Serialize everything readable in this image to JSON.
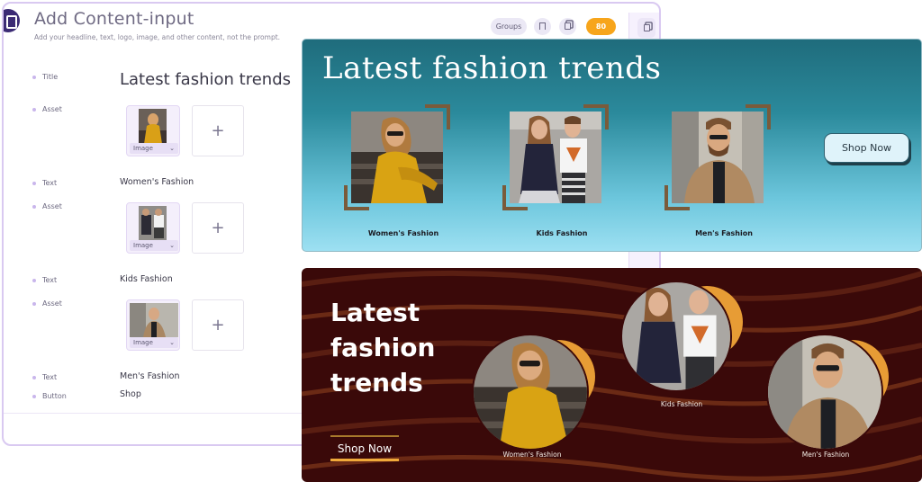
{
  "editor": {
    "title": "Add Content-input",
    "subtitle": "Add your headline, text, logo, image, and other content, not the prompt.",
    "groups_label": "Groups",
    "credits": "80",
    "rows": {
      "title_label": "Title",
      "title_value": "Latest fashion trends",
      "asset_label": "Asset",
      "text_label": "Text",
      "button_label": "Button",
      "asset_type": "Image",
      "text1_value": "Women's Fashion",
      "text2_value": "Kids Fashion",
      "text3_value": "Men's Fashion",
      "button_value": "Shop",
      "add_symbol": "+"
    }
  },
  "banner_teal": {
    "headline": "Latest fashion trends",
    "captions": [
      "Women's Fashion",
      "Kids Fashion",
      "Men's Fashion"
    ],
    "cta": "Shop Now"
  },
  "banner_brown": {
    "headline_lines": [
      "Latest",
      "fashion",
      "trends"
    ],
    "captions": [
      "Women's Fashion",
      "Kids Fashion",
      "Men's Fashion"
    ],
    "cta": "Shop Now"
  },
  "colors": {
    "accent_purple": "#d9c9f1",
    "credits_orange": "#f7a51b",
    "teal_dark": "#1f6c7c",
    "teal_light": "#9de0f2",
    "frame_brown": "#7a5b3b",
    "banner_maroon": "#3a0909",
    "blob_orange": "#e79c35"
  }
}
